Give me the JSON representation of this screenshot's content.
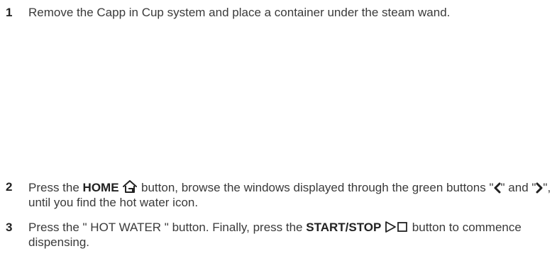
{
  "steps": [
    {
      "number": "1",
      "text": "Remove the Capp in Cup system and place a container under the steam wand."
    },
    {
      "number": "2",
      "text_before": "Press the ",
      "bold_label": "HOME",
      "icon": "home-icon",
      "text_mid": " button, browse the windows displayed through the green buttons \"",
      "left_icon": "chevron-left-icon",
      "text_mid2": "\" and \"",
      "right_icon": "chevron-right-icon",
      "text_after": "\", until you find the hot water icon."
    },
    {
      "number": "3",
      "text_before": "Press the \" HOT WATER \" button. Finally, press the ",
      "bold_label": "START/STOP",
      "icon": "start-stop-icon",
      "text_after": " button to commence dispensing."
    }
  ],
  "colors": {
    "text": "#3a3a3a",
    "bold": "#222222",
    "background": "#ffffff"
  }
}
